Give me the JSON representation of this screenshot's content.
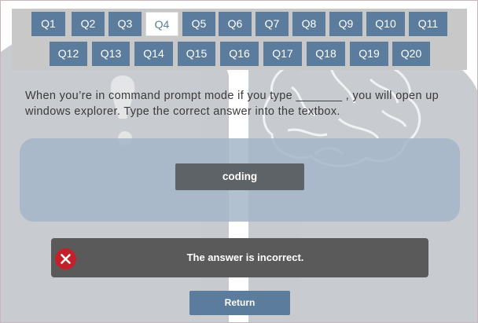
{
  "questions": [
    {
      "label": "Q1"
    },
    {
      "label": "Q2"
    },
    {
      "label": "Q3"
    },
    {
      "label": "Q4"
    },
    {
      "label": "Q5"
    },
    {
      "label": "Q6"
    },
    {
      "label": "Q7"
    },
    {
      "label": "Q8"
    },
    {
      "label": "Q9"
    },
    {
      "label": "Q10"
    },
    {
      "label": "Q11"
    },
    {
      "label": "Q12"
    },
    {
      "label": "Q13"
    },
    {
      "label": "Q14"
    },
    {
      "label": "Q15"
    },
    {
      "label": "Q16"
    },
    {
      "label": "Q17"
    },
    {
      "label": "Q18"
    },
    {
      "label": "Q19"
    },
    {
      "label": "Q20"
    }
  ],
  "active_question": "Q4",
  "question_text": "When you’re in command prompt mode if you type _______ , you will open up windows explorer. Type the correct answer into the textbox.",
  "answer_value": "coding",
  "feedback_text": "The answer is incorrect.",
  "return_label": "Return",
  "colors": {
    "question_button": "#5b7c9c",
    "feedback_background": "#5a5a5a",
    "incorrect_icon": "#c4202b"
  }
}
